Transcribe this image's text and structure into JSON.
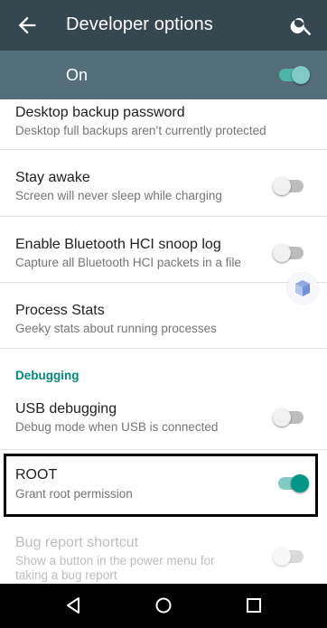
{
  "appbar": {
    "title": "Developer options",
    "back_icon": "arrow-back-icon",
    "search_icon": "search-icon"
  },
  "master": {
    "label": "On",
    "enabled": true
  },
  "settings": [
    {
      "title": "Desktop backup password",
      "summary": "Desktop full backups aren’t currently protected"
    },
    {
      "title": "Stay awake",
      "summary": "Screen will never sleep while charging",
      "toggle": false
    },
    {
      "title": "Enable Bluetooth HCI snoop log",
      "summary": "Capture all Bluetooth HCI packets in a file",
      "toggle": false
    },
    {
      "title": "Process Stats",
      "summary": "Geeky stats about running processes"
    }
  ],
  "section_header": "Debugging",
  "debugging": [
    {
      "title": "USB debugging",
      "summary": "Debug mode when USB is connected",
      "toggle": false
    },
    {
      "title": "ROOT",
      "summary": "Grant root permission",
      "toggle": true
    },
    {
      "title": "Bug report shortcut",
      "summary_line1": "Show a button in the power menu for",
      "summary_line2": "taking a bug report",
      "toggle": false,
      "disabled": true
    }
  ],
  "navbar": {
    "back_icon": "nav-back-icon",
    "home_icon": "nav-home-icon",
    "recents_icon": "nav-recents-icon"
  },
  "colors": {
    "appbar": "#37474f",
    "master_bar": "#546e7a",
    "accent": "#009688",
    "section": "#00897b"
  }
}
